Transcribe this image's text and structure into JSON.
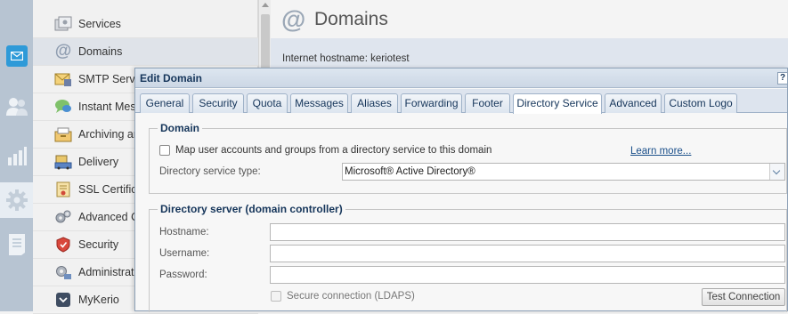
{
  "rail": {
    "icons": [
      "mail-icon",
      "users-icon",
      "bar-chart-icon",
      "gear-icon",
      "log-document-icon"
    ]
  },
  "nav": {
    "items": [
      {
        "label": "Services",
        "icon": "services-icon"
      },
      {
        "label": "Domains",
        "icon": "at-sign-icon"
      },
      {
        "label": "SMTP Serve",
        "icon": "smtp-server-icon"
      },
      {
        "label": "Instant Mes",
        "icon": "instant-messaging-icon"
      },
      {
        "label": "Archiving ar",
        "icon": "archiving-icon"
      },
      {
        "label": "Delivery",
        "icon": "delivery-icon"
      },
      {
        "label": "SSL Certifica",
        "icon": "ssl-certificate-icon"
      },
      {
        "label": "Advanced O",
        "icon": "advanced-gears-icon"
      },
      {
        "label": "Security",
        "icon": "security-shield-icon"
      },
      {
        "label": "Administrati",
        "icon": "administration-icon"
      },
      {
        "label": "MyKerio",
        "icon": "mykerio-icon"
      }
    ],
    "selected": "Domains"
  },
  "header": {
    "title": "Domains",
    "hostname": "Internet hostname: keriotest"
  },
  "dialog": {
    "title": "Edit Domain",
    "help": "?",
    "tabs": [
      {
        "label": "General"
      },
      {
        "label": "Security"
      },
      {
        "label": "Quota"
      },
      {
        "label": "Messages"
      },
      {
        "label": "Aliases"
      },
      {
        "label": "Forwarding"
      },
      {
        "label": "Footer"
      },
      {
        "label": "Directory Service"
      },
      {
        "label": "Advanced"
      },
      {
        "label": "Custom Logo"
      }
    ],
    "active_tab": "Directory Service",
    "domain_section": {
      "legend": "Domain",
      "map_checkbox_label": "Map user accounts and groups from a directory service to this domain",
      "map_checked": false,
      "learn_more": "Learn more...",
      "type_label": "Directory service type:",
      "type_value": "Microsoft® Active Directory®"
    },
    "server_section": {
      "legend": "Directory server (domain controller)",
      "hostname_label": "Hostname:",
      "hostname_value": "",
      "username_label": "Username:",
      "username_value": "",
      "password_label": "Password:",
      "password_value": "",
      "secure_label": "Secure connection (LDAPS)",
      "secure_checked": false,
      "test_button": "Test Connection"
    }
  },
  "colors": {
    "accent_blue": "#2e9ad8",
    "dialog_border": "#8da1b7",
    "legend_text": "#15355a"
  }
}
